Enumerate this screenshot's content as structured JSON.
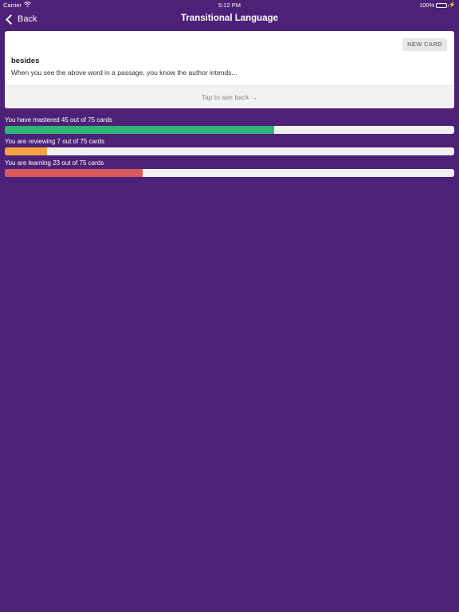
{
  "status_bar": {
    "carrier": "Carrier",
    "time": "5:12 PM",
    "battery_text": "100%"
  },
  "nav": {
    "back_label": "Back",
    "title": "Transitional Language"
  },
  "card": {
    "new_card_label": "NEW CARD",
    "term": "besides",
    "prompt": "When you see the above word in a passage, you know the author intends...",
    "flip_label": "Tap to see back"
  },
  "progress": [
    {
      "label": "You have mastered 45 out of 75 cards",
      "count": 45,
      "total": 75,
      "color": "#2bb673"
    },
    {
      "label": "You are reviewing 7 out of 75 cards",
      "count": 7,
      "total": 75,
      "color": "#f4a340"
    },
    {
      "label": "You are learning 23 out of 75 cards",
      "count": 23,
      "total": 75,
      "color": "#d9595c"
    }
  ],
  "colors": {
    "background": "#4d2177",
    "card": "#ffffff"
  }
}
